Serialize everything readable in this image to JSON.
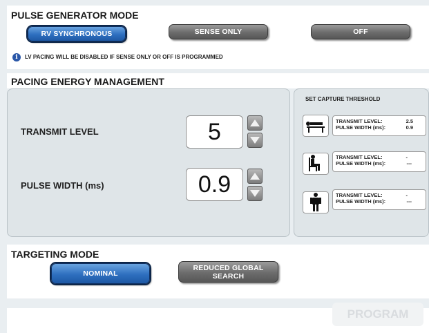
{
  "pulse_generator": {
    "title": "PULSE GENERATOR MODE",
    "buttons": [
      "RV SYNCHRONOUS",
      "SENSE ONLY",
      "OFF"
    ],
    "selected": "RV SYNCHRONOUS",
    "note": "LV PACING WILL BE DISABLED IF SENSE ONLY OR OFF IS PROGRAMMED"
  },
  "pacing_energy": {
    "title": "PACING ENERGY MANAGEMENT",
    "transmit_label": "TRANSMIT LEVEL",
    "transmit_value": "5",
    "pulse_label": "PULSE WIDTH (ms)",
    "pulse_value": "0.9"
  },
  "capture": {
    "title": "SET CAPTURE THRESHOLD",
    "rows": [
      {
        "icon": "lying-person-icon",
        "transmit_label": "TRANSMIT LEVEL:",
        "transmit_value": "2.5",
        "pulse_label": "PULSE WIDTH (ms):",
        "pulse_value": "0.9"
      },
      {
        "icon": "sitting-person-icon",
        "transmit_label": "TRANSMIT LEVEL:",
        "transmit_value": "-",
        "pulse_label": "PULSE WIDTH (ms):",
        "pulse_value": "---"
      },
      {
        "icon": "standing-person-icon",
        "transmit_label": "TRANSMIT LEVEL:",
        "transmit_value": "-",
        "pulse_label": "PULSE WIDTH (ms):",
        "pulse_value": "---"
      }
    ]
  },
  "targeting": {
    "title": "TARGETING MODE",
    "nominal_label": "NOMINAL",
    "reduced_label": "REDUCED GLOBAL SEARCH",
    "selected": "NOMINAL"
  },
  "program_label": "PROGRAM",
  "colors": {
    "selected_blue": "#2e6fbf",
    "unselected_gray": "#6c6c6c",
    "background": "#e9eef1"
  }
}
